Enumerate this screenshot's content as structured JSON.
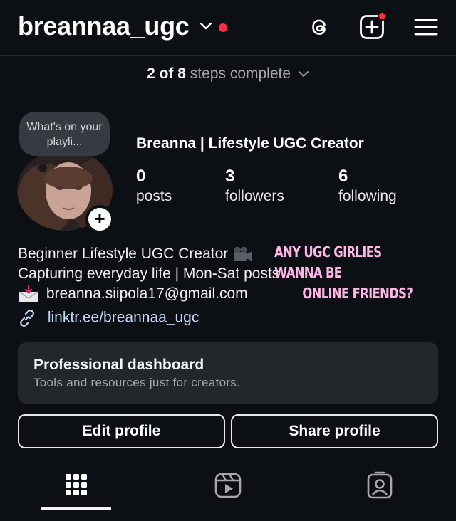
{
  "header": {
    "username": "breannaa_ugc"
  },
  "onboarding": {
    "progress": "2 of 8",
    "label": "steps complete"
  },
  "profile": {
    "note_bubble": "What's on your playli...",
    "display_name": "Breanna | Lifestyle UGC Creator",
    "stats": [
      {
        "value": "0",
        "label": "posts"
      },
      {
        "value": "3",
        "label": "followers"
      },
      {
        "value": "6",
        "label": "following"
      }
    ],
    "bio": {
      "line1": "Beginner Lifestyle UGC Creator",
      "line2": "Capturing everyday life | Mon-Sat posts",
      "email": "breanna.siipola17@gmail.com"
    },
    "overlay_text": {
      "line1": "ANY UGC GIRLIES WANNA BE",
      "line2": "ONLINE FRIENDS?"
    },
    "link": "linktr.ee/breannaa_ugc"
  },
  "dashboard": {
    "title": "Professional dashboard",
    "subtitle": "Tools and resources just for creators."
  },
  "buttons": {
    "edit": "Edit profile",
    "share": "Share profile"
  },
  "colors": {
    "background": "#0c1014",
    "notification": "#ff3040",
    "overlay_text": "#ffb6e6",
    "link": "#c7d6f5"
  }
}
